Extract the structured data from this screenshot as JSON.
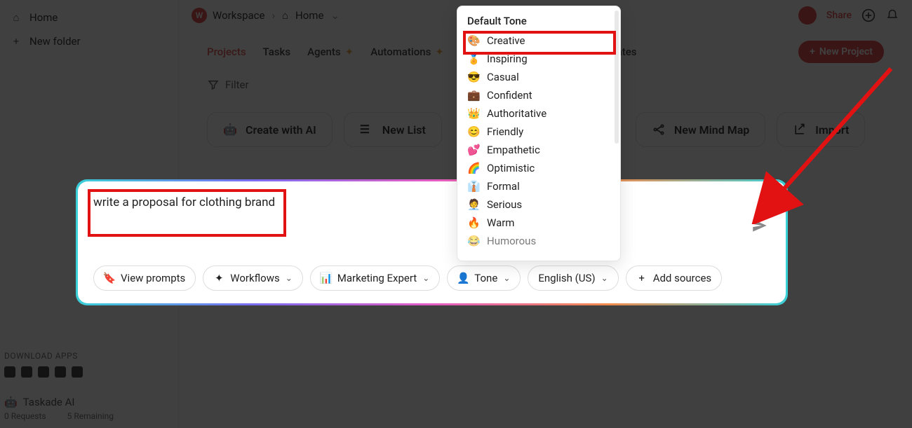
{
  "sidebar": {
    "home": "Home",
    "new_folder": "New folder",
    "download_apps": "DOWNLOAD APPS",
    "taskade_ai": "Taskade AI",
    "requests": "0 Requests",
    "remaining": "5 Remaining"
  },
  "header": {
    "workspace_badge": "W",
    "workspace": "Workspace",
    "home": "Home",
    "share": "Share"
  },
  "tabs": {
    "projects": "Projects",
    "tasks": "Tasks",
    "agents": "Agents",
    "automations": "Automations",
    "templates": "Templates",
    "new_project": "New Project"
  },
  "filter": {
    "label": "Filter"
  },
  "actions": {
    "create_ai": "Create with AI",
    "new_list": "New List",
    "new_mind_map": "New Mind Map",
    "import": "Import"
  },
  "tone_dropdown": {
    "header": "Default Tone",
    "items": [
      {
        "emoji": "🎨",
        "label": "Creative"
      },
      {
        "emoji": "🏅",
        "label": "Inspiring"
      },
      {
        "emoji": "😎",
        "label": "Casual"
      },
      {
        "emoji": "💼",
        "label": "Confident"
      },
      {
        "emoji": "👑",
        "label": "Authoritative"
      },
      {
        "emoji": "😊",
        "label": "Friendly"
      },
      {
        "emoji": "💕",
        "label": "Empathetic"
      },
      {
        "emoji": "🌈",
        "label": "Optimistic"
      },
      {
        "emoji": "👔",
        "label": "Formal"
      },
      {
        "emoji": "🧑‍💼",
        "label": "Serious"
      },
      {
        "emoji": "🔥",
        "label": "Warm"
      },
      {
        "emoji": "😂",
        "label": "Humorous"
      }
    ]
  },
  "prompt": {
    "text": "write a proposal for clothing brand",
    "chips": {
      "view_prompts": "View prompts",
      "workflows": "Workflows",
      "persona": "Marketing Expert",
      "tone": "Tone",
      "language": "English (US)",
      "add_sources": "Add sources"
    }
  }
}
